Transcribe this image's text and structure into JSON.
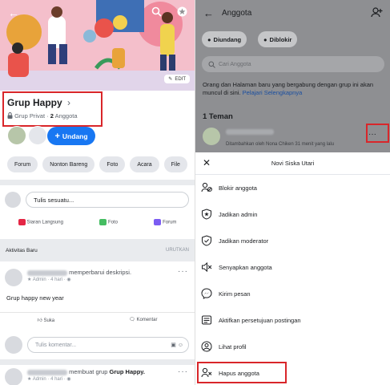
{
  "left": {
    "group": {
      "title": "Grup Happy",
      "chevron": "›",
      "privacy": "Grup Privat",
      "dot": "·",
      "count": "2",
      "count_label": "Anggota"
    },
    "edit_label": "EDIT",
    "invite_label": "Undang",
    "chips": [
      "Forum",
      "Nonton Bareng",
      "Foto",
      "Acara",
      "File"
    ],
    "composer_placeholder": "Tulis sesuatu...",
    "actions": [
      "Siaran Langsung",
      "Foto",
      "Forum"
    ],
    "activity_title": "Aktivitas Baru",
    "activity_sort": "URUTKAN",
    "post1": {
      "action": "memperbarui deskripsi.",
      "meta": "Admin · 4 hari ·",
      "text": "Grup happy new year"
    },
    "like_label": "Suka",
    "comment_label": "Komentar",
    "comment_placeholder": "Tulis komentar...",
    "post2": {
      "action": "membuat grup",
      "group": "Grup Happy.",
      "meta": "Admin · 4 hari ·"
    }
  },
  "right": {
    "title": "Anggota",
    "chips": [
      "Diundang",
      "Diblokir"
    ],
    "search_placeholder": "Cari Anggota",
    "note": "Orang dan Halaman baru yang bergabung dengan grup ini akan muncul di sini.",
    "note_link": "Pelajari Selengkapnya",
    "friends_title": "1 Teman",
    "member_meta": "Ditambahkan oleh Nona Chiken 31 menit yang lalu",
    "sheet_title": "Novi Siska Utari",
    "menu": [
      "Blokir anggota",
      "Jadikan admin",
      "Jadikan moderator",
      "Senyapkan anggota",
      "Kirim pesan",
      "Aktifkan persetujuan postingan",
      "Lihat profil",
      "Hapus anggota"
    ]
  },
  "colors": {
    "accent": "#1877f2",
    "highlight": "#d9262a",
    "overlay": "#8e8f92"
  }
}
